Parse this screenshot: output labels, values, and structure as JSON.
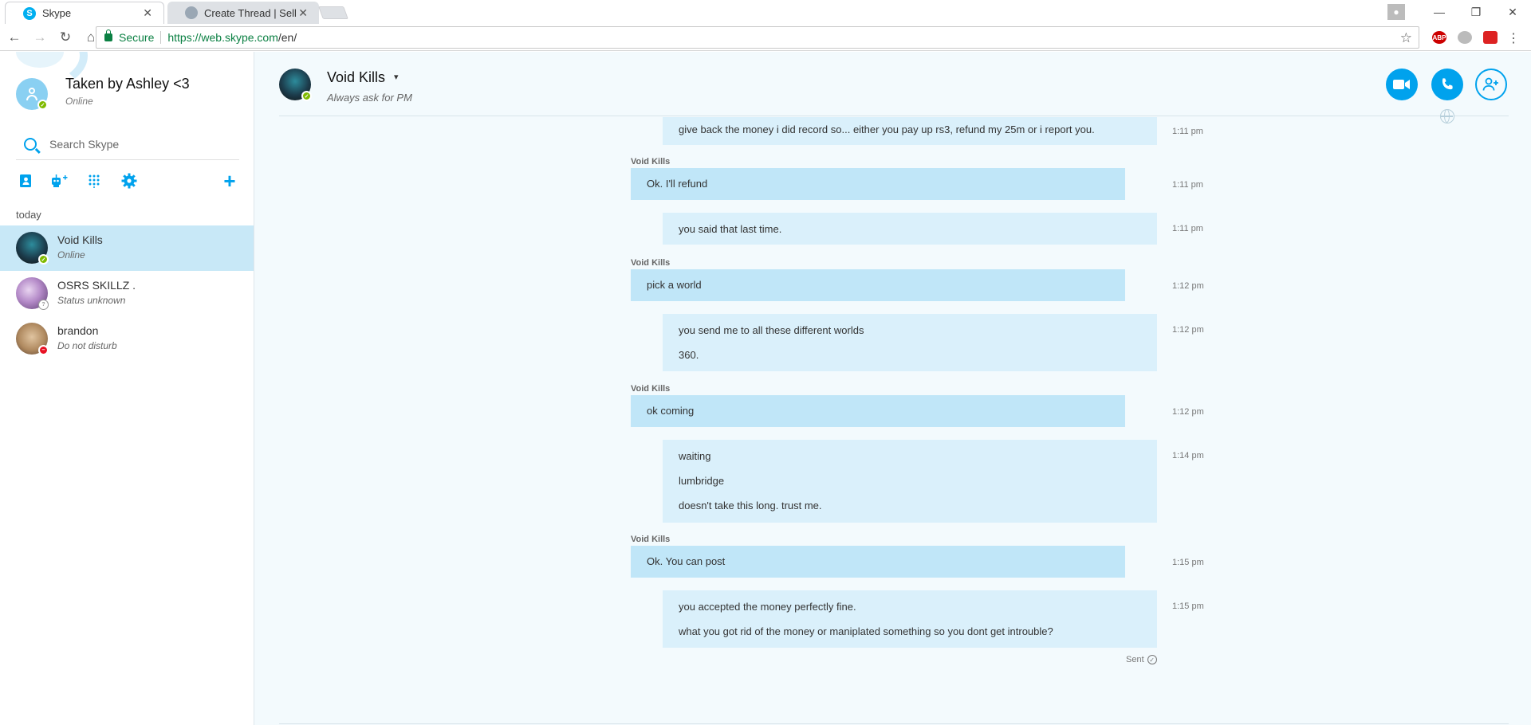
{
  "browser": {
    "tabs": [
      {
        "title": "Skype",
        "active": true
      },
      {
        "title": "Create Thread | Sell & Tr",
        "active": false
      }
    ],
    "secure_label": "Secure",
    "url_host": "https://web.skype.com",
    "url_path": "/en/",
    "ext_abp": "ABP"
  },
  "profile": {
    "name": "Taken by Ashley <3",
    "status": "Online"
  },
  "search": {
    "placeholder": "Search Skype"
  },
  "sidebar": {
    "section_label": "today",
    "contacts": [
      {
        "name": "Void Kills",
        "status": "Online",
        "presence": "online"
      },
      {
        "name": "OSRS SKILLZ .",
        "status": "Status unknown",
        "presence": "unknown"
      },
      {
        "name": "brandon",
        "status": "Do not disturb",
        "presence": "dnd"
      }
    ]
  },
  "chat": {
    "name": "Void Kills",
    "mood": "Always ask for PM",
    "sent_label": "Sent",
    "messages": [
      {
        "from": "me",
        "lines": [
          "give back the money i did record so... either you pay up rs3, refund my 25m or i report you."
        ],
        "time": "1:11 pm"
      },
      {
        "from": "them",
        "sender": "Void Kills",
        "lines": [
          "Ok. I'll refund"
        ],
        "time": "1:11 pm"
      },
      {
        "from": "me",
        "lines": [
          "you said that last time."
        ],
        "time": "1:11 pm"
      },
      {
        "from": "them",
        "sender": "Void Kills",
        "lines": [
          "pick a world"
        ],
        "time": "1:12 pm"
      },
      {
        "from": "me",
        "lines": [
          "you send me to all these different worlds",
          "360."
        ],
        "time": "1:12 pm"
      },
      {
        "from": "them",
        "sender": "Void Kills",
        "lines": [
          "ok coming"
        ],
        "time": "1:12 pm"
      },
      {
        "from": "me",
        "lines": [
          "waiting",
          "lumbridge",
          "doesn't take this long. trust me."
        ],
        "time": "1:14 pm"
      },
      {
        "from": "them",
        "sender": "Void Kills",
        "lines": [
          "Ok. You can post"
        ],
        "time": "1:15 pm"
      },
      {
        "from": "me",
        "lines": [
          "you accepted the money perfectly fine.",
          "what you got rid of the money or maniplated something so you dont get introuble?"
        ],
        "time": "1:15 pm"
      }
    ]
  },
  "colors": {
    "accent": "#00a2ed",
    "online": "#7fba00",
    "dnd": "#e81123",
    "bubble_in": "#c0e6f8",
    "bubble_out": "#daf0fb"
  }
}
